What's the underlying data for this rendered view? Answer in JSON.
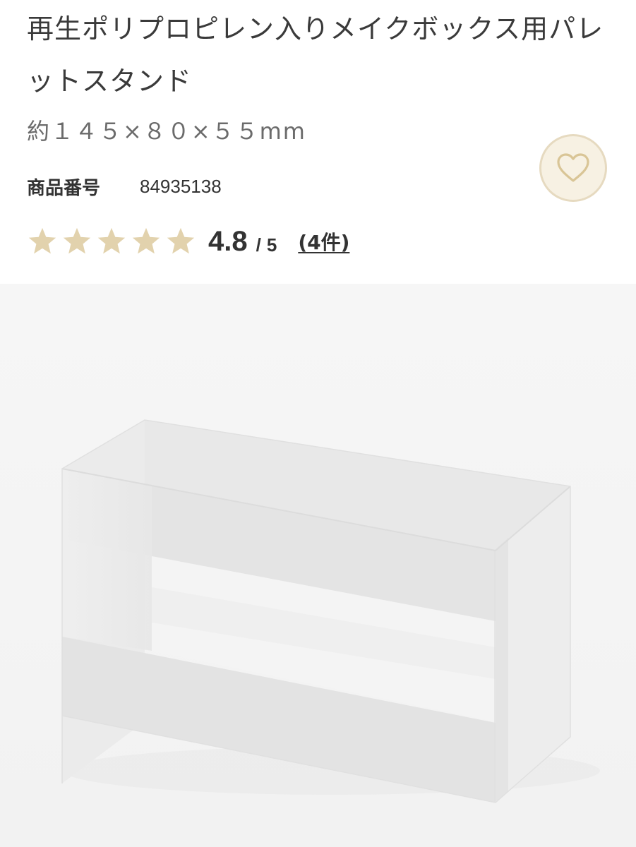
{
  "product": {
    "title": "再生ポリプロピレン入りメイクボックス用パレットスタンド",
    "size": "約１４５×８０×５５mm",
    "code_label": "商品番号",
    "code_value": "84935138"
  },
  "rating": {
    "value": "4.8",
    "separator": "/",
    "max": "5",
    "stars_filled": 4.8,
    "review_count_text": "(4件)"
  },
  "icons": {
    "favorite": "heart-icon",
    "rating": "star-icon"
  },
  "colors": {
    "star": "#e2d2ad",
    "favorite_bg": "#f7f1e3",
    "favorite_border": "#e6dac0",
    "favorite_heart": "#d9c596",
    "image_bg": "#f5f5f5"
  }
}
